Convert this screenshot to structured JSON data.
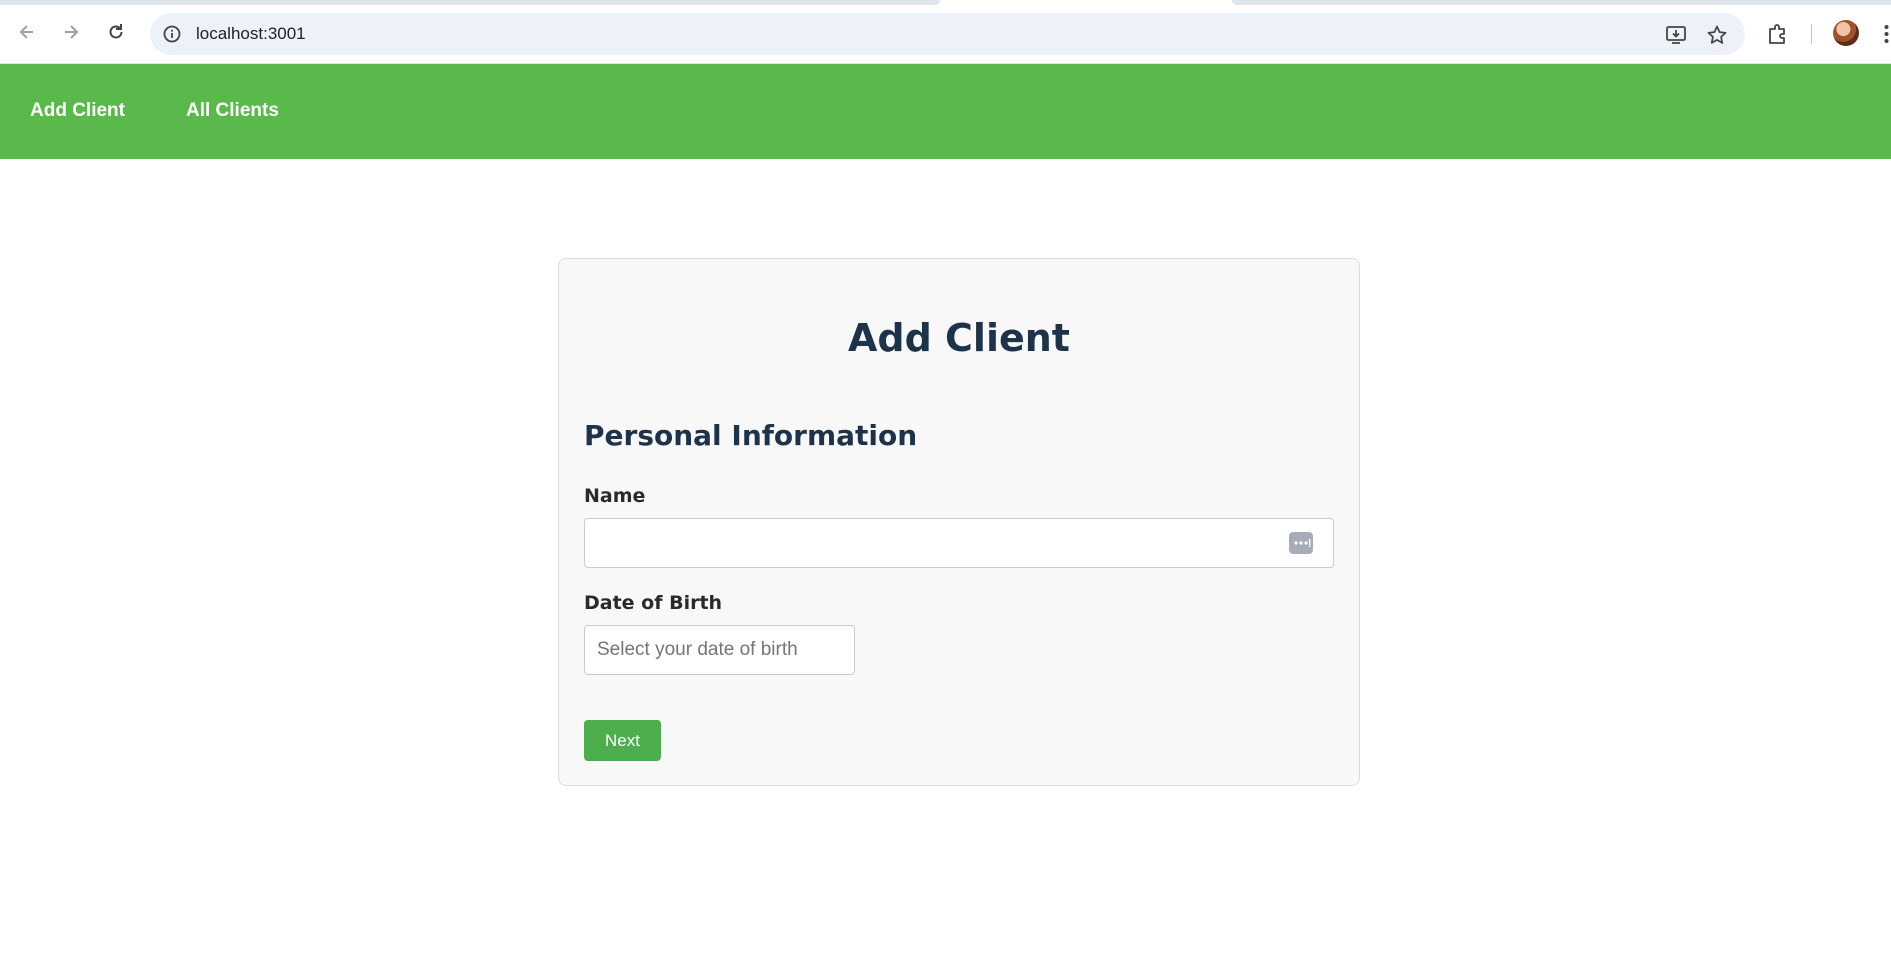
{
  "browser": {
    "url": "localhost:3001",
    "icons": {
      "back": "arrow-left-icon",
      "forward": "arrow-right-icon",
      "reload": "reload-icon",
      "site_info": "info-icon",
      "install": "install-app-icon",
      "bookmark": "star-icon",
      "extensions": "puzzle-icon",
      "profile": "avatar",
      "menu": "kebab-menu-icon"
    }
  },
  "nav": {
    "background": "#59b94a",
    "items": [
      {
        "label": "Add Client"
      },
      {
        "label": "All Clients"
      }
    ]
  },
  "form": {
    "title": "Add Client",
    "section": "Personal Information",
    "name_label": "Name",
    "name_value": "",
    "dob_label": "Date of Birth",
    "dob_value": "",
    "dob_placeholder": "Select your date of birth",
    "next_label": "Next",
    "accent": "#4cae4c",
    "heading_color": "#1d3349"
  }
}
